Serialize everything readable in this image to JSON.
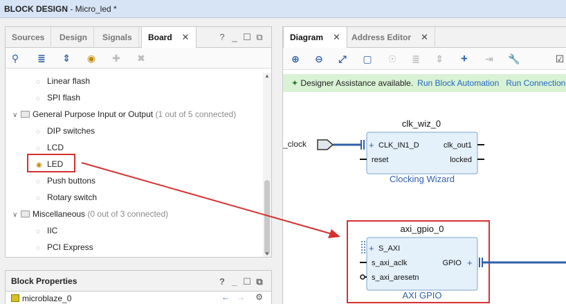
{
  "title": {
    "app": "BLOCK DESIGN",
    "doc": " - Micro_led *"
  },
  "left_panel": {
    "tabs": [
      {
        "label": "Sources"
      },
      {
        "label": "Design"
      },
      {
        "label": "Signals"
      },
      {
        "label": "Board",
        "active": true
      }
    ],
    "tab_close": "✕",
    "window_controls": [
      "?",
      "_",
      "☐",
      "⧉"
    ],
    "tree": {
      "rows": [
        {
          "label": "Linear flash"
        },
        {
          "label": "SPI flash"
        },
        {
          "label": "General Purpose Input or Output",
          "note": "(1 out of 5 connected)"
        },
        {
          "label": "DIP switches"
        },
        {
          "label": "LCD"
        },
        {
          "label": "LED"
        },
        {
          "label": "Push buttons"
        },
        {
          "label": "Rotary switch"
        },
        {
          "label": "Miscellaneous",
          "note": "(0 out of 3 connected)"
        },
        {
          "label": "IIC"
        },
        {
          "label": "PCI Express"
        }
      ]
    }
  },
  "block_properties": {
    "title": "Block Properties",
    "item": "microblaze_0",
    "window_controls": [
      "?",
      "_",
      "☐",
      "⧉"
    ]
  },
  "diagram": {
    "tabs": [
      {
        "label": "Diagram",
        "active": true
      },
      {
        "label": "Address Editor"
      }
    ],
    "tab_close": "✕",
    "banner": {
      "text": "Designer Assistance available.",
      "link1": "Run Block Automation",
      "link2": "Run Connection Automation"
    },
    "external_port": "_clock",
    "blocks": [
      {
        "name": "clk_wiz_0",
        "subtitle": "Clocking Wizard",
        "left_ports": [
          "CLK_IN1_D",
          "reset"
        ],
        "right_ports": [
          "clk_out1",
          "locked"
        ]
      },
      {
        "name": "axi_gpio_0",
        "subtitle": "AXI GPIO",
        "left_ports": [
          "S_AXI",
          "s_axi_aclk",
          "s_axi_aresetn"
        ],
        "right_ports": [
          "GPIO"
        ]
      }
    ]
  },
  "colors": {
    "accent_blue": "#2e5fa8",
    "annotation_red": "#d53030",
    "block_fill": "#e4f0fa",
    "block_stroke": "#7aa6cc",
    "banner_green": "#d9f2d4"
  }
}
